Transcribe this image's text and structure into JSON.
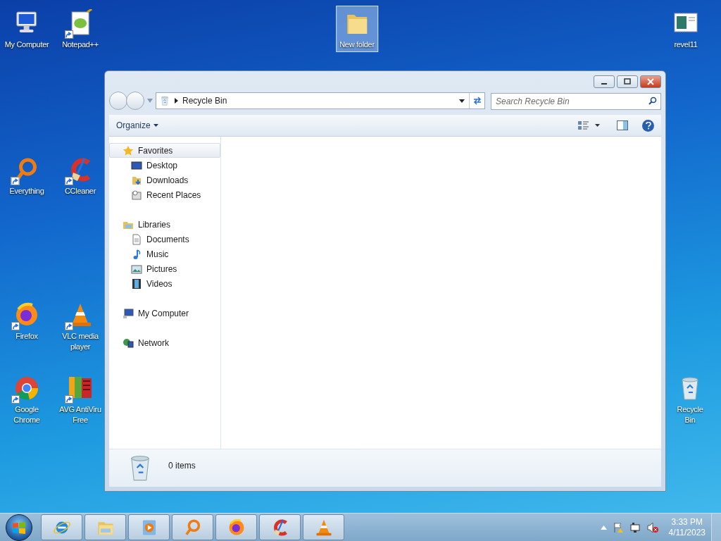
{
  "desktop_icons": [
    {
      "kind": "computer",
      "label": "My Computer",
      "shortcut": false,
      "selected": false
    },
    {
      "kind": "notepad",
      "label": "Notepad++",
      "shortcut": true,
      "selected": false
    },
    {
      "kind": "folder",
      "label": "New folder",
      "shortcut": false,
      "selected": true
    },
    {
      "kind": "document",
      "label": "revel11",
      "shortcut": false,
      "selected": false
    },
    {
      "kind": "everything",
      "label": "Everything",
      "shortcut": true,
      "selected": false
    },
    {
      "kind": "ccleaner",
      "label": "CCleaner",
      "shortcut": true,
      "selected": false
    },
    {
      "kind": "firefox",
      "label": "Firefox",
      "shortcut": true,
      "selected": false
    },
    {
      "kind": "vlc",
      "label": "VLC media player",
      "shortcut": true,
      "selected": false
    },
    {
      "kind": "chrome",
      "label": "Google Chrome",
      "shortcut": true,
      "selected": false
    },
    {
      "kind": "avg",
      "label": "AVG AntiViru Free",
      "shortcut": true,
      "selected": false
    },
    {
      "kind": "recycle",
      "label": "Recycle Bin",
      "shortcut": false,
      "selected": false
    }
  ],
  "window": {
    "address": "Recycle Bin",
    "search": {
      "placeholder": "Search Recycle Bin"
    },
    "organize": "Organize",
    "nav": [
      {
        "kind": "star",
        "label": "Favorites",
        "selected": true,
        "children": [
          {
            "kind": "desktop",
            "label": "Desktop",
            "selected": false
          },
          {
            "kind": "downloads",
            "label": "Downloads",
            "selected": false
          },
          {
            "kind": "recent",
            "label": "Recent Places",
            "selected": false
          }
        ]
      },
      {
        "kind": "libraries",
        "label": "Libraries",
        "selected": false,
        "children": [
          {
            "kind": "documents",
            "label": "Documents",
            "selected": false
          },
          {
            "kind": "music",
            "label": "Music",
            "selected": false
          },
          {
            "kind": "pictures",
            "label": "Pictures",
            "selected": false
          },
          {
            "kind": "videos",
            "label": "Videos",
            "selected": false
          }
        ]
      },
      {
        "kind": "computer",
        "label": "My Computer",
        "selected": false
      },
      {
        "kind": "network",
        "label": "Network",
        "selected": false
      }
    ],
    "details": {
      "count": "0 items"
    }
  },
  "taskbar": {
    "pinned": [
      {
        "kind": "ie"
      },
      {
        "kind": "explorer"
      },
      {
        "kind": "media"
      },
      {
        "kind": "everything"
      },
      {
        "kind": "firefox"
      },
      {
        "kind": "ccleaner"
      },
      {
        "kind": "vlc"
      }
    ],
    "time": "3:33 PM",
    "date": "4/11/2023"
  }
}
